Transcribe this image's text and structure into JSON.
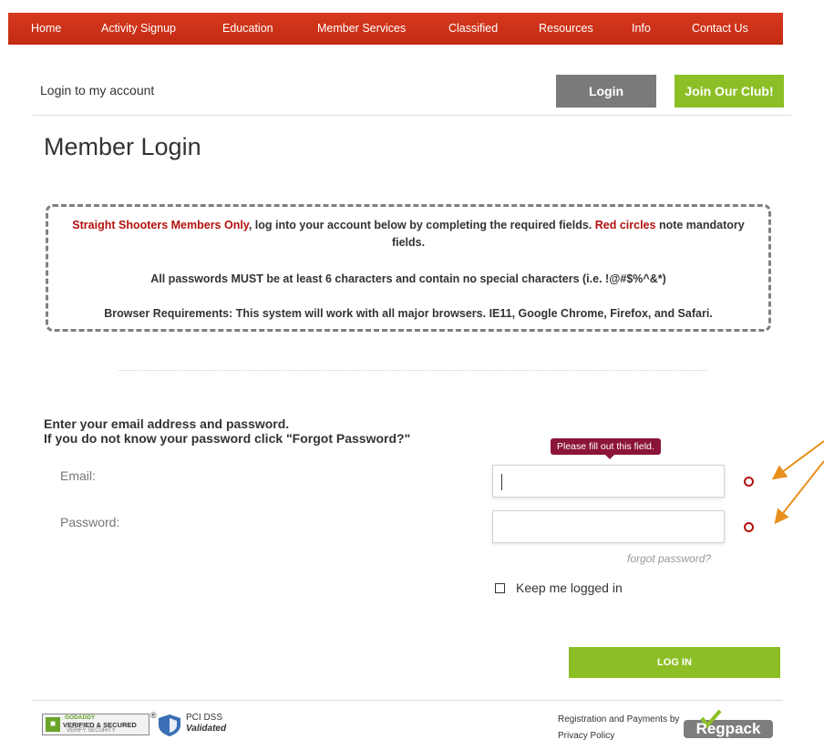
{
  "nav": {
    "items": [
      "Home",
      "Activity Signup",
      "Education",
      "Member Services",
      "Classified",
      "Resources",
      "Info",
      "Contact Us"
    ]
  },
  "account": {
    "label": "Login to my account",
    "login_button": "Login",
    "join_button": "Join Our Club!"
  },
  "page_title": "Member Login",
  "notice": {
    "line1_highlight": "Straight Shooters Members Only",
    "line1_mid": ", log into your account below by completing the required fields. ",
    "line1_red": "Red circles",
    "line1_end": " note mandatory fields.",
    "line2": "All passwords MUST be at least 6 characters and contain no special characters (i.e. !@#$%^&*)",
    "line3": "Browser Requirements: This system will work with all major browsers. IE11, Google Chrome, Firefox, and Safari."
  },
  "form": {
    "instruction_1": "Enter your email address and password.",
    "instruction_2": "If you do not know your password click \"Forgot Password?\"",
    "email_label": "Email:",
    "password_label": "Password:",
    "email_value": "",
    "password_value": "",
    "validation_tooltip": "Please fill out this field.",
    "forgot_link": "forgot password?",
    "keep_logged_in": "Keep me logged in",
    "keep_logged_in_checked": false,
    "submit_button": "LOG IN"
  },
  "footer": {
    "godaddy_brand": "GODADDY",
    "godaddy_main": "VERIFIED & SECURED",
    "godaddy_sub": "VERIFY SECURITY",
    "registered_mark": "®",
    "pci_line1": "PCI DSS",
    "pci_line2": "Validated",
    "registration_text": "Registration and Payments by",
    "privacy_link": "Privacy Policy",
    "regpack_logo": "Regpack"
  },
  "colors": {
    "nav_bg": "#c9301a",
    "accent_green": "#8cbf26",
    "login_gray": "#7a7a7a",
    "required_red": "#b3120e",
    "tooltip_bg": "#8b1538",
    "annotation_arrow": "#e8901c"
  }
}
